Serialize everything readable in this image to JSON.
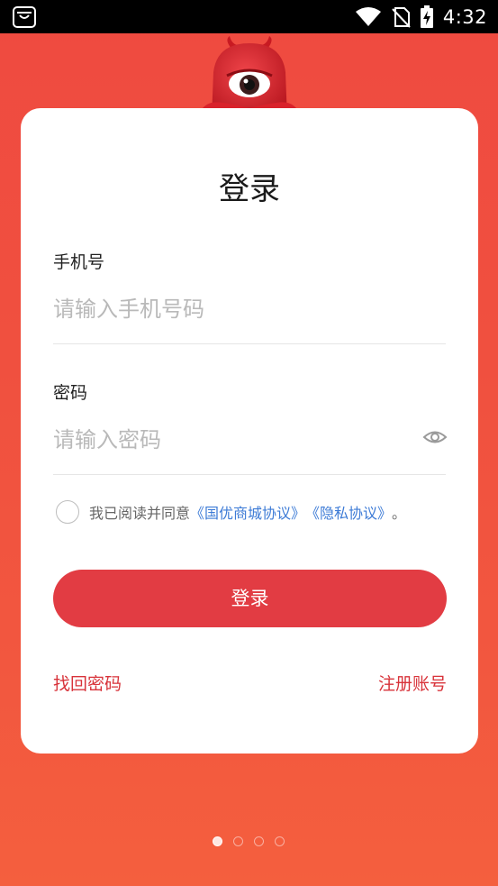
{
  "status_bar": {
    "time": "4:32"
  },
  "login": {
    "title": "登录",
    "phone": {
      "label": "手机号",
      "placeholder": "请输入手机号码",
      "value": ""
    },
    "password": {
      "label": "密码",
      "placeholder": "请输入密码",
      "value": ""
    },
    "agreement": {
      "prefix": "我已阅读并同意",
      "link_terms": "《国优商城协议》",
      "link_privacy": "《隐私协议》",
      "suffix": "。",
      "checked": false
    },
    "submit_label": "登录",
    "forgot_password": "找回密码",
    "register": "注册账号"
  },
  "pager": {
    "count": 4,
    "active_index": 0
  },
  "colors": {
    "background_top": "#ef4a40",
    "background_bottom": "#f45f3e",
    "primary_button": "#e23c43",
    "accent_link": "#d8333a",
    "agreement_link": "#3d7bd6"
  },
  "icons": [
    "shopping-bag-icon",
    "wifi-icon",
    "no-sim-icon",
    "battery-charging-icon",
    "eye-icon",
    "mascot-icon"
  ]
}
